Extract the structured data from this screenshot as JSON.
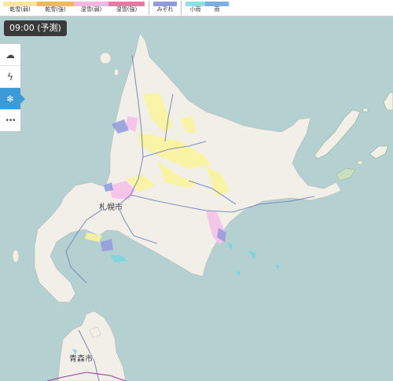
{
  "legend": {
    "items": [
      {
        "label": "乾雪(弱)",
        "color": "#fbe5a0"
      },
      {
        "label": "乾雪(強)",
        "color": "#f0b860"
      },
      {
        "label": "湿雪(弱)",
        "color": "#f4b8e0"
      },
      {
        "label": "湿雪(強)",
        "color": "#e57ba0"
      },
      {
        "label": "みぞれ",
        "color": "#8f9bdc"
      },
      {
        "label": "小雨",
        "color": "#8fe0e6"
      },
      {
        "label": "雨",
        "color": "#7ab0e6"
      }
    ]
  },
  "time_label": "09:00 (予測)",
  "tools": [
    {
      "name": "rain-cloud-icon",
      "glyph": "☁"
    },
    {
      "name": "lightning-icon",
      "glyph": "ϟ"
    },
    {
      "name": "snowflake-icon",
      "glyph": "❄"
    },
    {
      "name": "more-icon",
      "glyph": "•••"
    }
  ],
  "cities": {
    "sapporo": "札幌市",
    "aomori": "青森市"
  },
  "colors": {
    "sea": "#b4d0d1",
    "land": "#f2efe9",
    "forest": "#c8dfc0",
    "road": "#6f83b8",
    "rail": "#9b3a9b"
  }
}
